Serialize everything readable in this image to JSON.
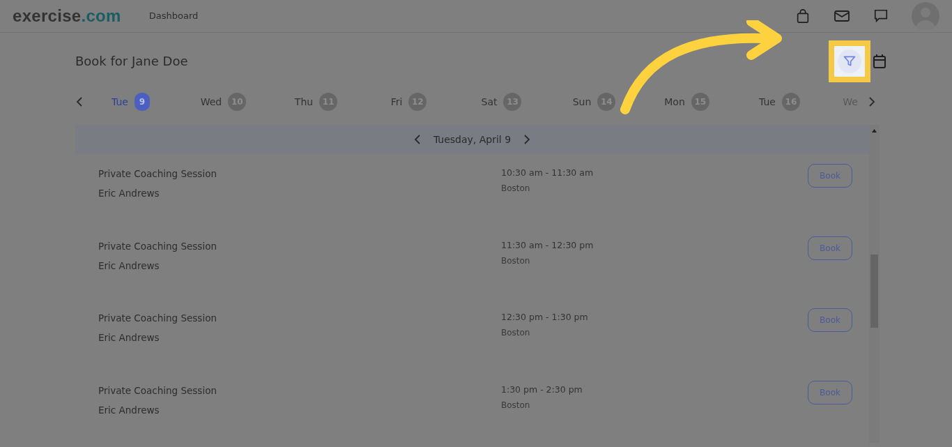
{
  "navbar": {
    "logo_main": "exercise",
    "logo_accent": ".com",
    "links": [
      "Dashboard"
    ]
  },
  "heading": "Book for Jane Doe",
  "toolbar": {
    "filter_highlighted": true
  },
  "days": [
    {
      "label": "Tue",
      "number": "9",
      "selected": true,
      "faded": false
    },
    {
      "label": "Wed",
      "number": "10",
      "selected": false,
      "faded": false
    },
    {
      "label": "Thu",
      "number": "11",
      "selected": false,
      "faded": false
    },
    {
      "label": "Fri",
      "number": "12",
      "selected": false,
      "faded": false
    },
    {
      "label": "Sat",
      "number": "13",
      "selected": false,
      "faded": false
    },
    {
      "label": "Sun",
      "number": "14",
      "selected": false,
      "faded": false
    },
    {
      "label": "Mon",
      "number": "15",
      "selected": false,
      "faded": false
    },
    {
      "label": "Tue",
      "number": "16",
      "selected": false,
      "faded": false
    },
    {
      "label": "We",
      "selected": false,
      "faded": true
    }
  ],
  "date_header": "Tuesday, April 9",
  "sessions": [
    {
      "title": "Private Coaching Session",
      "coach": "Eric Andrews",
      "time": "10:30 am - 11:30 am",
      "location": "Boston",
      "button": "Book"
    },
    {
      "title": "Private Coaching Session",
      "coach": "Eric Andrews",
      "time": "11:30 am - 12:30 pm",
      "location": "Boston",
      "button": "Book"
    },
    {
      "title": "Private Coaching Session",
      "coach": "Eric Andrews",
      "time": "12:30 pm - 1:30 pm",
      "location": "Boston",
      "button": "Book"
    },
    {
      "title": "Private Coaching Session",
      "coach": "Eric Andrews",
      "time": "1:30 pm - 2:30 pm",
      "location": "Boston",
      "button": "Book"
    }
  ]
}
